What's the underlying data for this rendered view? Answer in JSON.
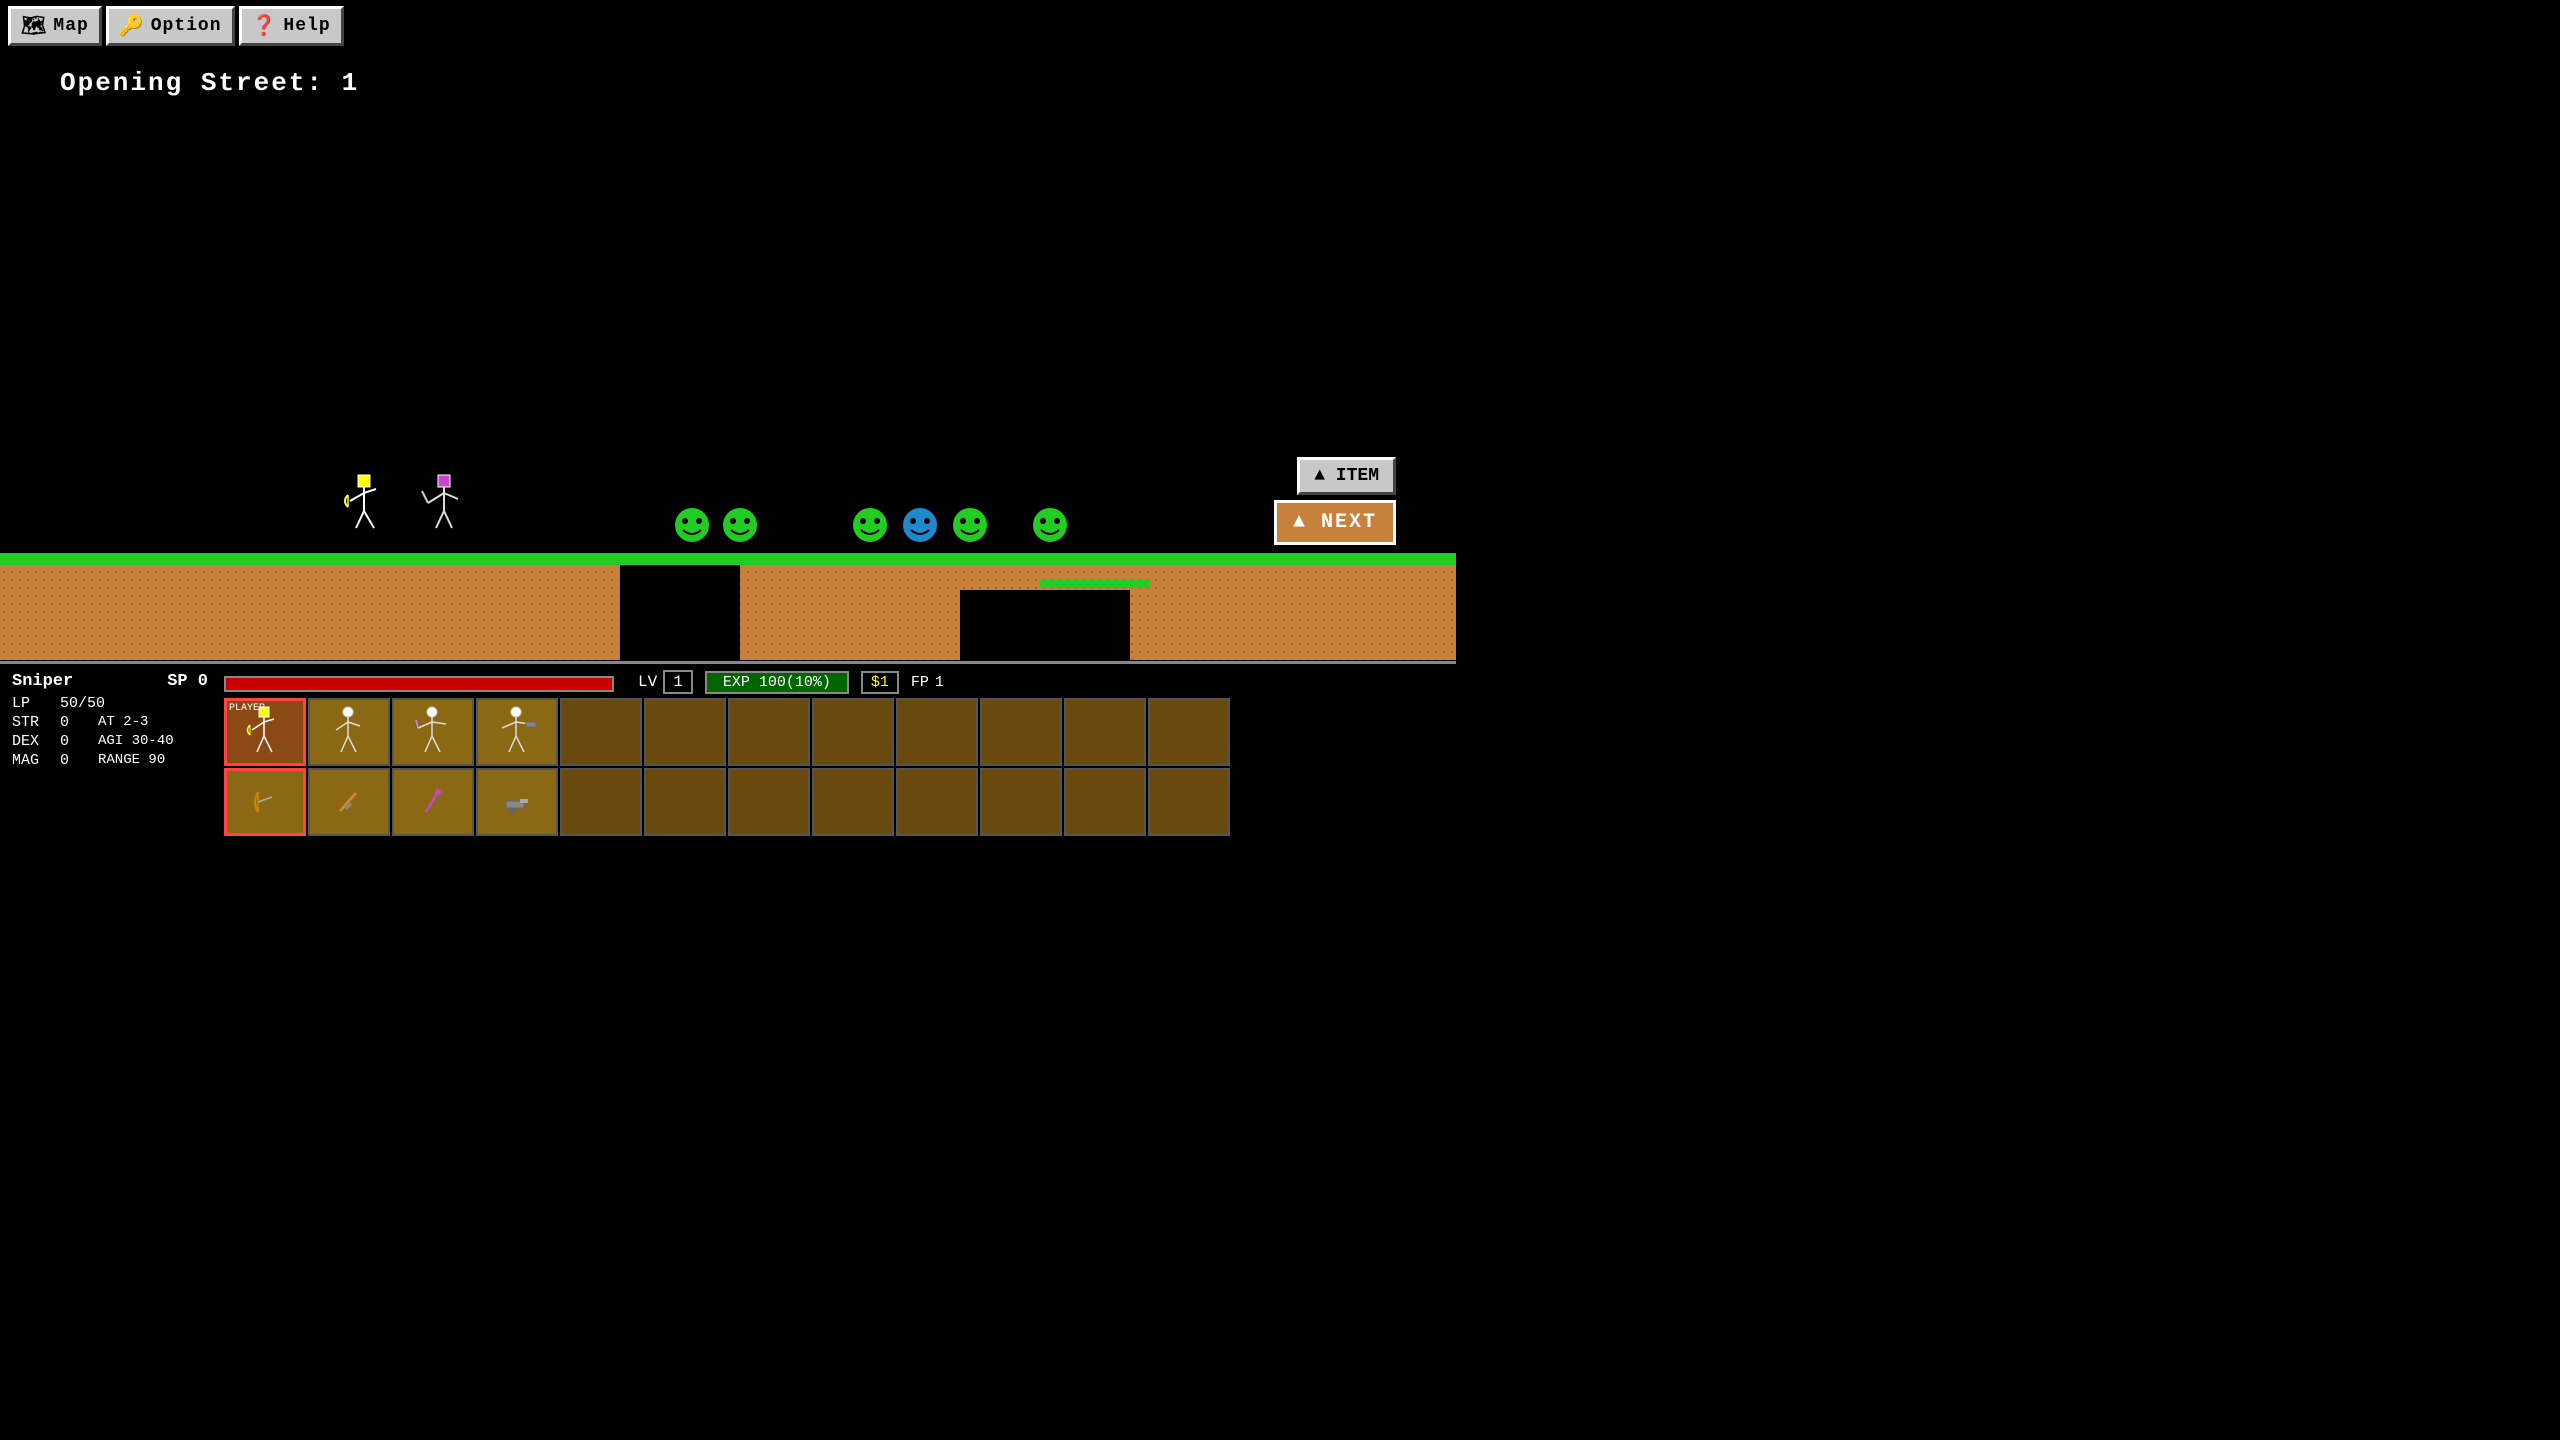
{
  "nav": {
    "map_label": "Map",
    "option_label": "Option",
    "help_label": "Help",
    "map_icon": "🗺",
    "option_icon": "🔑",
    "help_icon": "❓"
  },
  "location": {
    "text": "Opening Street: 1"
  },
  "hud": {
    "class_name": "Sniper",
    "sp_label": "SP",
    "sp_value": "0",
    "lp_label": "LP",
    "lp_current": "50",
    "lp_max": "50",
    "str_label": "STR",
    "str_value": "0",
    "at_label": "AT",
    "at_value": "2-3",
    "dex_label": "DEX",
    "dex_value": "0",
    "agi_label": "AGI",
    "agi_value": "30-40",
    "mag_label": "MAG",
    "mag_value": "0",
    "range_label": "RANGE",
    "range_value": "90",
    "lv_label": "LV",
    "lv_value": "1",
    "exp_label": "EXP",
    "exp_value": "100(10%)",
    "money_value": "$1",
    "fp_label": "FP",
    "fp_value": "1",
    "hp_percent": 100
  },
  "inventory": {
    "top_row": [
      {
        "label": "PLAYER",
        "has_char": true,
        "selected": true,
        "char_type": "archer",
        "weapon": "bow"
      },
      {
        "label": "",
        "has_char": true,
        "selected": false,
        "char_type": "archer2",
        "weapon": "bow2"
      },
      {
        "label": "",
        "has_char": true,
        "selected": false,
        "char_type": "archer3",
        "weapon": "staff"
      },
      {
        "label": "",
        "has_char": true,
        "selected": false,
        "char_type": "gunner",
        "weapon": "gun"
      },
      {
        "label": "",
        "has_char": false,
        "selected": false
      },
      {
        "label": "",
        "has_char": false,
        "selected": false
      },
      {
        "label": "",
        "has_char": false,
        "selected": false
      },
      {
        "label": "",
        "has_char": false,
        "selected": false
      },
      {
        "label": "",
        "has_char": false,
        "selected": false
      },
      {
        "label": "",
        "has_char": false,
        "selected": false
      },
      {
        "label": "",
        "has_char": false,
        "selected": false
      },
      {
        "label": "",
        "has_char": false,
        "selected": false
      }
    ],
    "bottom_row": [
      {
        "label": "",
        "has_item": true,
        "item_type": "bow_small"
      },
      {
        "label": "",
        "has_item": true,
        "item_type": "dagger"
      },
      {
        "label": "",
        "has_item": true,
        "item_type": "staff_item"
      },
      {
        "label": "",
        "has_item": true,
        "item_type": "gun_item"
      },
      {
        "label": "",
        "has_item": false
      },
      {
        "label": "",
        "has_item": false
      },
      {
        "label": "",
        "has_item": false
      },
      {
        "label": "",
        "has_item": false
      },
      {
        "label": "",
        "has_item": false
      },
      {
        "label": "",
        "has_item": false
      },
      {
        "label": "",
        "has_item": false
      },
      {
        "label": "",
        "has_item": false
      }
    ]
  },
  "buttons": {
    "next_label": "▲ NEXT",
    "item_label": "▲ ITEM"
  },
  "colors": {
    "background": "#000000",
    "ground": "#c8813a",
    "grass": "#22cc22",
    "hud_bg": "#000000",
    "inv_cell": "#8b6914",
    "inv_selected": "#8b4914",
    "hp_bar": "#cc0000",
    "exp_bar": "#006600"
  }
}
